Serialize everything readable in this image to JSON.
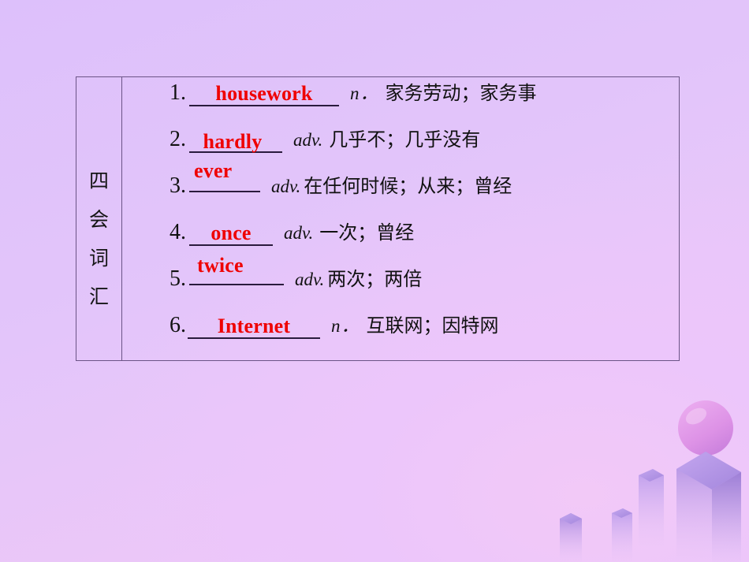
{
  "slide": {
    "background_color": "#e2c4fa",
    "accent_answer_color": "#ef0000",
    "table_border_color": "#6b5486"
  },
  "table": {
    "category_label": "四会词汇",
    "category_chars": [
      "四",
      "会",
      "词",
      "汇"
    ],
    "entries": [
      {
        "number": "1.",
        "answer": "housework",
        "part_of_speech": "n．",
        "meaning": "家务劳动；家务事"
      },
      {
        "number": "2.",
        "answer": "hardly",
        "part_of_speech": "adv.",
        "meaning": "几乎不；几乎没有"
      },
      {
        "number": "3.",
        "answer": "ever",
        "part_of_speech": "adv.",
        "meaning": "在任何时候；从来；曾经"
      },
      {
        "number": "4.",
        "answer": "once",
        "part_of_speech": "adv.",
        "meaning": "一次；曾经"
      },
      {
        "number": "5.",
        "answer": "twice",
        "part_of_speech": "adv.",
        "meaning": "两次；两倍"
      },
      {
        "number": "6.",
        "answer": "Internet",
        "part_of_speech": "n．",
        "meaning": "互联网；因特网"
      }
    ]
  },
  "decoration": {
    "sphere": "sphere-shape",
    "buildings": "city-skyline-shape"
  }
}
